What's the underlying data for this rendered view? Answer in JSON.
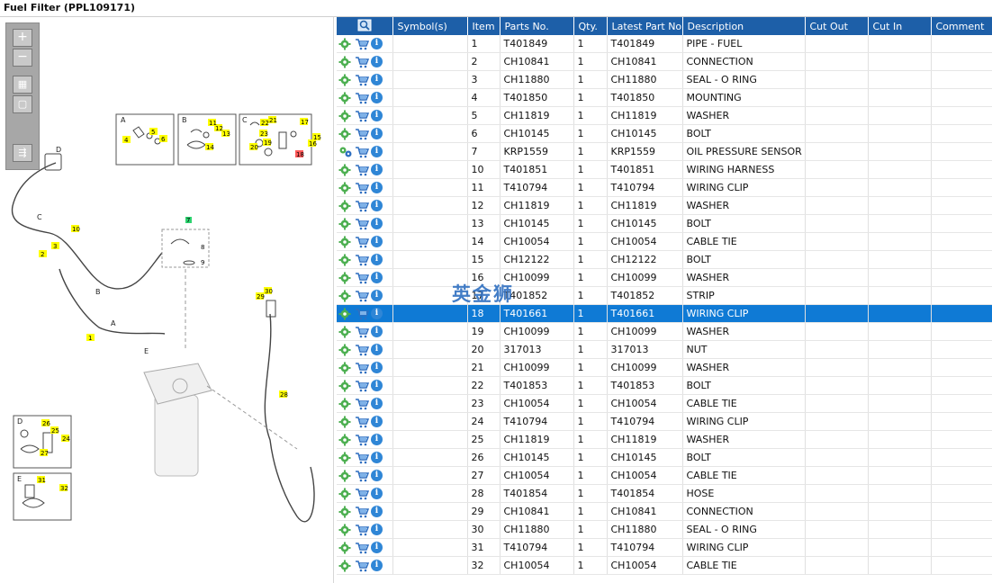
{
  "window": {
    "title": "Fuel Filter (PPL109171)"
  },
  "toolbar": {
    "zoom_in": "+",
    "zoom_out": "−",
    "fit": "▦",
    "reset": "▢",
    "export": "⇶"
  },
  "diagram": {
    "labels": [
      "A",
      "B",
      "C",
      "D",
      "E"
    ],
    "callouts": [
      "1",
      "2",
      "3",
      "4",
      "5",
      "6",
      "7",
      "8",
      "9",
      "10",
      "11",
      "12",
      "13",
      "14",
      "15",
      "16",
      "17",
      "18",
      "19",
      "20",
      "21",
      "22",
      "23",
      "24",
      "25",
      "26",
      "27",
      "28",
      "29",
      "30",
      "31",
      "32"
    ],
    "callout_color": "#ffff00",
    "highlight_callout": "18",
    "highlight_color": "#ff5a5a",
    "green_callout": "7",
    "green_color": "#2dd36f"
  },
  "table": {
    "headers": [
      "",
      "Symbol(s)",
      "Item",
      "Parts No.",
      "Qty.",
      "Latest Part No.",
      "Description",
      "Cut Out",
      "Cut In",
      "Comment"
    ],
    "header_color": "#1d5fa8",
    "selected_color": "#0f7ad5",
    "selected_item": "18",
    "rows": [
      {
        "item": "1",
        "part": "T401849",
        "qty": "1",
        "latest": "T401849",
        "desc": "PIPE - FUEL"
      },
      {
        "item": "2",
        "part": "CH10841",
        "qty": "1",
        "latest": "CH10841",
        "desc": "CONNECTION"
      },
      {
        "item": "3",
        "part": "CH11880",
        "qty": "1",
        "latest": "CH11880",
        "desc": "SEAL - O RING"
      },
      {
        "item": "4",
        "part": "T401850",
        "qty": "1",
        "latest": "T401850",
        "desc": "MOUNTING"
      },
      {
        "item": "5",
        "part": "CH11819",
        "qty": "1",
        "latest": "CH11819",
        "desc": "WASHER"
      },
      {
        "item": "6",
        "part": "CH10145",
        "qty": "1",
        "latest": "CH10145",
        "desc": "BOLT"
      },
      {
        "item": "7",
        "part": "KRP1559",
        "qty": "1",
        "latest": "KRP1559",
        "desc": "OIL PRESSURE SENSOR KIT"
      },
      {
        "item": "10",
        "part": "T401851",
        "qty": "1",
        "latest": "T401851",
        "desc": "WIRING HARNESS"
      },
      {
        "item": "11",
        "part": "T410794",
        "qty": "1",
        "latest": "T410794",
        "desc": "WIRING CLIP"
      },
      {
        "item": "12",
        "part": "CH11819",
        "qty": "1",
        "latest": "CH11819",
        "desc": "WASHER"
      },
      {
        "item": "13",
        "part": "CH10145",
        "qty": "1",
        "latest": "CH10145",
        "desc": "BOLT"
      },
      {
        "item": "14",
        "part": "CH10054",
        "qty": "1",
        "latest": "CH10054",
        "desc": "CABLE TIE"
      },
      {
        "item": "15",
        "part": "CH12122",
        "qty": "1",
        "latest": "CH12122",
        "desc": "BOLT"
      },
      {
        "item": "16",
        "part": "CH10099",
        "qty": "1",
        "latest": "CH10099",
        "desc": "WASHER"
      },
      {
        "item": "17",
        "part": "T401852",
        "qty": "1",
        "latest": "T401852",
        "desc": "STRIP"
      },
      {
        "item": "18",
        "part": "T401661",
        "qty": "1",
        "latest": "T401661",
        "desc": "WIRING CLIP"
      },
      {
        "item": "19",
        "part": "CH10099",
        "qty": "1",
        "latest": "CH10099",
        "desc": "WASHER"
      },
      {
        "item": "20",
        "part": "317013",
        "qty": "1",
        "latest": "317013",
        "desc": "NUT"
      },
      {
        "item": "21",
        "part": "CH10099",
        "qty": "1",
        "latest": "CH10099",
        "desc": "WASHER"
      },
      {
        "item": "22",
        "part": "T401853",
        "qty": "1",
        "latest": "T401853",
        "desc": "BOLT"
      },
      {
        "item": "23",
        "part": "CH10054",
        "qty": "1",
        "latest": "CH10054",
        "desc": "CABLE TIE"
      },
      {
        "item": "24",
        "part": "T410794",
        "qty": "1",
        "latest": "T410794",
        "desc": "WIRING CLIP"
      },
      {
        "item": "25",
        "part": "CH11819",
        "qty": "1",
        "latest": "CH11819",
        "desc": "WASHER"
      },
      {
        "item": "26",
        "part": "CH10145",
        "qty": "1",
        "latest": "CH10145",
        "desc": "BOLT"
      },
      {
        "item": "27",
        "part": "CH10054",
        "qty": "1",
        "latest": "CH10054",
        "desc": "CABLE TIE"
      },
      {
        "item": "28",
        "part": "T401854",
        "qty": "1",
        "latest": "T401854",
        "desc": "HOSE"
      },
      {
        "item": "29",
        "part": "CH10841",
        "qty": "1",
        "latest": "CH10841",
        "desc": "CONNECTION"
      },
      {
        "item": "30",
        "part": "CH11880",
        "qty": "1",
        "latest": "CH11880",
        "desc": "SEAL - O RING"
      },
      {
        "item": "31",
        "part": "T410794",
        "qty": "1",
        "latest": "T410794",
        "desc": "WIRING CLIP"
      },
      {
        "item": "32",
        "part": "CH10054",
        "qty": "1",
        "latest": "CH10054",
        "desc": "CABLE TIE"
      }
    ]
  },
  "icons": {
    "row_icons": [
      "gear-icon",
      "cart-icon",
      "info-icon"
    ],
    "kit_row_icon": "gears-icon",
    "header_icon": "search-icon"
  },
  "watermark": "英金狮"
}
